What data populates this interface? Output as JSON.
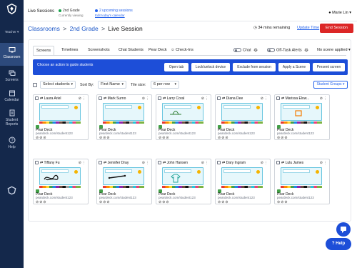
{
  "sidebar": {
    "teacher_label": "Teacher ▾",
    "items": [
      {
        "label": "Classroom",
        "icon": "monitor-icon",
        "active": true
      },
      {
        "label": "Screens",
        "icon": "screens-icon",
        "active": false
      },
      {
        "label": "Calendar",
        "icon": "calendar-icon",
        "active": false
      },
      {
        "label": "Student Reports",
        "icon": "reports-icon",
        "active": false
      },
      {
        "label": "Help",
        "icon": "help-icon",
        "active": false
      }
    ]
  },
  "topbar": {
    "title": "Live Sessions",
    "status1": {
      "label": "2nd Grade",
      "sub": "Currently viewing",
      "color": "#16a34a"
    },
    "status2": {
      "label": "2 upcoming sessions",
      "link": "Edit today's calendar",
      "color": "#2563eb"
    },
    "user": "Marie Lin"
  },
  "header": {
    "crumb1": "Classrooms",
    "crumb2": "2nd Grade",
    "crumb3": "Live Session",
    "sep": ">",
    "timer": "34 mins remaining",
    "update": "Update Time",
    "end": "End Session"
  },
  "tabs": [
    "Screens",
    "Timelines",
    "Screenshots",
    "Chat Students",
    "Pear Deck",
    "Check-Ins"
  ],
  "toggles": {
    "chat": "Chat",
    "offtask": "Off-Task Alerts",
    "scene": "No scene applied"
  },
  "action_bar": {
    "text": "Choose an action to guide students",
    "buttons": [
      "Open tab",
      "Lock/unlock device",
      "Exclude from session",
      "Apply a Scene",
      "Present screen"
    ]
  },
  "controls": {
    "select_students": "Select students",
    "sort_label": "Sort By:",
    "sort_value": "First Name",
    "tile_label": "Tile size:",
    "tile_value": "6 per row",
    "groups": "Student Groups"
  },
  "students": [
    {
      "name": "Laura Ariel",
      "src": "Pear Deck",
      "url": "peardeck.com/student123",
      "draw": "none"
    },
    {
      "name": "Mark Surno",
      "src": "Pear Deck",
      "url": "peardeck.com/student123",
      "draw": "none"
    },
    {
      "name": "Larry Coral",
      "src": "Pear Deck",
      "url": "peardeck.com/student123",
      "draw": "hat"
    },
    {
      "name": "Diana Dee",
      "src": "Pear Deck",
      "url": "peardeck.com/student123",
      "draw": "none"
    },
    {
      "name": "Marissa Elow...",
      "src": "Pear Deck",
      "url": "peardeck.com/student123",
      "draw": "box"
    },
    {
      "name": "Tiffany Fu",
      "src": "Pear Deck",
      "url": "peardeck.com/student123",
      "draw": "scribble"
    },
    {
      "name": "Jennifer Dray",
      "src": "Pear Deck",
      "url": "peardeck.com/student123",
      "draw": "line"
    },
    {
      "name": "John Hansen",
      "src": "Pear Deck",
      "url": "peardeck.com/student123",
      "draw": "shirt"
    },
    {
      "name": "Dary Ingram",
      "src": "Pear Deck",
      "url": "peardeck.com/student123",
      "draw": "none"
    },
    {
      "name": "Lulu James",
      "src": "Pear Deck",
      "url": "peardeck.com/student123",
      "draw": "none"
    }
  ],
  "help": "Help"
}
